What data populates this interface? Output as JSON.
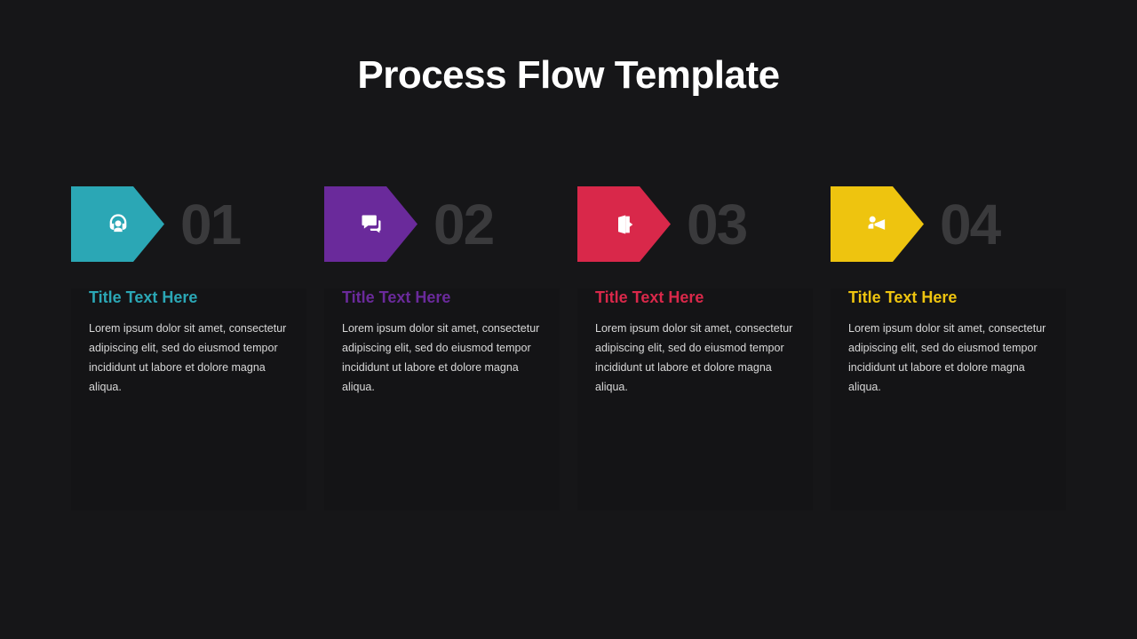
{
  "title": "Process Flow Template",
  "steps": [
    {
      "number": "01",
      "title": "Title Text Here",
      "desc": "Lorem ipsum dolor sit amet, consectetur adipiscing elit, sed do eiusmod tempor incididunt ut labore et dolore magna aliqua.",
      "icon": "headset-icon",
      "color": "#2ba7b5"
    },
    {
      "number": "02",
      "title": "Title Text Here",
      "desc": "Lorem ipsum dolor sit amet, consectetur adipiscing elit, sed do eiusmod tempor incididunt ut labore et dolore magna aliqua.",
      "icon": "chat-icon",
      "color": "#6a2a9b"
    },
    {
      "number": "03",
      "title": "Title Text Here",
      "desc": "Lorem ipsum dolor sit amet, consectetur adipiscing elit, sed do eiusmod tempor incididunt ut labore et dolore magna aliqua.",
      "icon": "door-exit-icon",
      "color": "#d9284a"
    },
    {
      "number": "04",
      "title": "Title Text Here",
      "desc": "Lorem ipsum dolor sit amet, consectetur adipiscing elit, sed do eiusmod tempor incididunt ut labore et dolore magna aliqua.",
      "icon": "megaphone-icon",
      "color": "#eec40f"
    }
  ]
}
